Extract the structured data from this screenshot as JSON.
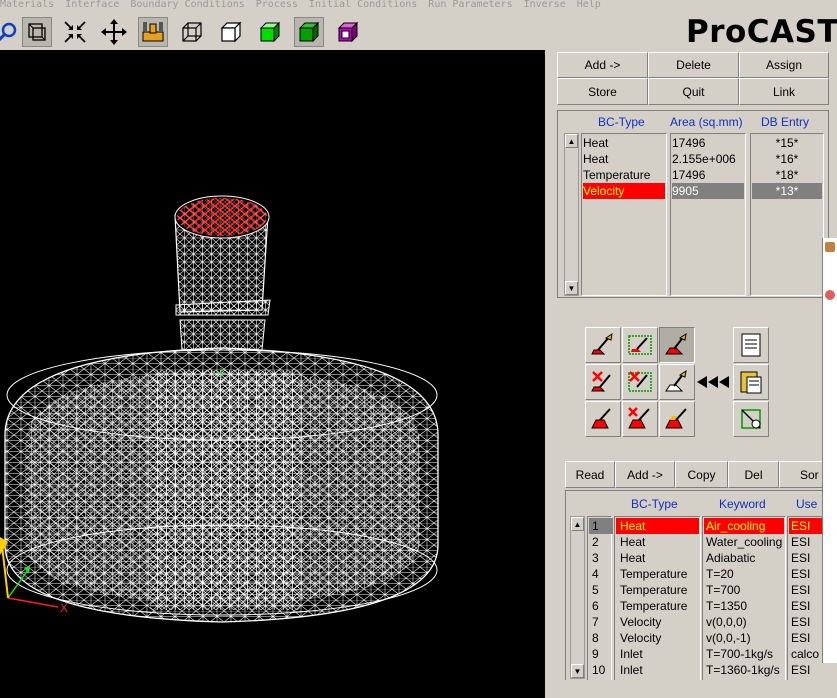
{
  "menu": [
    "Materials",
    "Interface",
    "Boundary Conditions",
    "Process",
    "Initial Conditions",
    "Run Parameters",
    "Inverse",
    "Help"
  ],
  "logo": "ProCAST",
  "bc_buttons": {
    "add": "Add ->",
    "delete": "Delete",
    "assign": "Assign",
    "store": "Store",
    "quit": "Quit",
    "link": "Link"
  },
  "assigned": {
    "headers": {
      "type": "BC-Type",
      "area": "Area (sq.mm)",
      "db": "DB Entry"
    },
    "rows": [
      {
        "type": "Heat",
        "area": "17496",
        "db": "*15*"
      },
      {
        "type": "Heat",
        "area": "2.155e+006",
        "db": "*16*"
      },
      {
        "type": "Temperature",
        "area": "17496",
        "db": "*18*"
      },
      {
        "type": "Velocity",
        "area": "9905",
        "db": "*13*"
      }
    ]
  },
  "db_buttons": {
    "read": "Read",
    "add": "Add ->",
    "copy": "Copy",
    "del": "Del",
    "sort": "Sor"
  },
  "database": {
    "headers": {
      "type": "BC-Type",
      "keyword": "Keyword",
      "user": "Use"
    },
    "rows": [
      {
        "n": "1",
        "type": "Heat",
        "keyword": "Air_cooling",
        "user": "ESI"
      },
      {
        "n": "2",
        "type": "Heat",
        "keyword": "Water_cooling",
        "user": "ESI"
      },
      {
        "n": "3",
        "type": "Heat",
        "keyword": "Adiabatic",
        "user": "ESI"
      },
      {
        "n": "4",
        "type": "Temperature",
        "keyword": "T=20",
        "user": "ESI"
      },
      {
        "n": "5",
        "type": "Temperature",
        "keyword": "T=700",
        "user": "ESI"
      },
      {
        "n": "6",
        "type": "Temperature",
        "keyword": "T=1350",
        "user": "ESI"
      },
      {
        "n": "7",
        "type": "Velocity",
        "keyword": "v(0,0,0)",
        "user": "ESI"
      },
      {
        "n": "8",
        "type": "Velocity",
        "keyword": "v(0,0,-1)",
        "user": "ESI"
      },
      {
        "n": "9",
        "type": "Inlet",
        "keyword": "T=700-1kg/s",
        "user": "calco"
      },
      {
        "n": "10",
        "type": "Inlet",
        "keyword": "T=1360-1kg/s",
        "user": "ESI"
      }
    ]
  },
  "axis_label": "X",
  "colors": {
    "selection": "#ff0000",
    "selection_text": "#ffff00",
    "header_text": "#1030c0",
    "viewport_bg": "#000000",
    "mesh": "#ffffff"
  }
}
